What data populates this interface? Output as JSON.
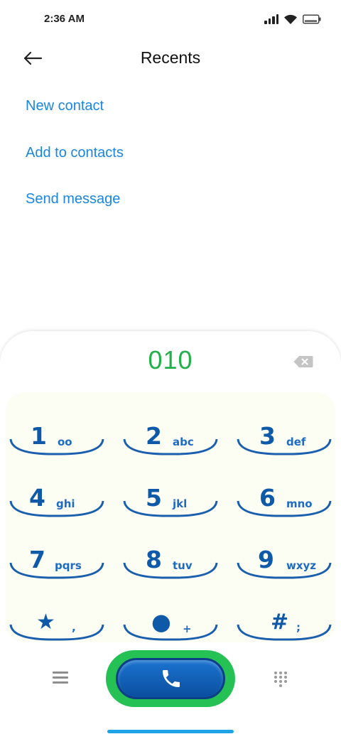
{
  "status_bar": {
    "time": "2:36 AM"
  },
  "header": {
    "title": "Recents"
  },
  "actions": [
    {
      "label": "New contact"
    },
    {
      "label": "Add to contacts"
    },
    {
      "label": "Send message"
    }
  ],
  "dialer": {
    "number": "010",
    "number_color": "#22b04a",
    "keys": [
      {
        "digit": "1",
        "letters": "oo"
      },
      {
        "digit": "2",
        "letters": "abc"
      },
      {
        "digit": "3",
        "letters": "def"
      },
      {
        "digit": "4",
        "letters": "ghi"
      },
      {
        "digit": "5",
        "letters": "jkl"
      },
      {
        "digit": "6",
        "letters": "mno"
      },
      {
        "digit": "7",
        "letters": "pqrs"
      },
      {
        "digit": "8",
        "letters": "tuv"
      },
      {
        "digit": "9",
        "letters": "wxyz"
      },
      {
        "digit": "★",
        "letters": ","
      },
      {
        "digit": "●",
        "letters": "+"
      },
      {
        "digit": "#",
        "letters": ";"
      }
    ]
  },
  "colors": {
    "accent_link": "#1a86e0",
    "call_ring": "#25c154",
    "key_blue": "#0f5aa8"
  },
  "icons": {
    "back": "arrow-left-icon",
    "backspace": "backspace-icon",
    "menu": "menu-icon",
    "call": "phone-icon",
    "keypad": "keypad-grid-icon"
  }
}
